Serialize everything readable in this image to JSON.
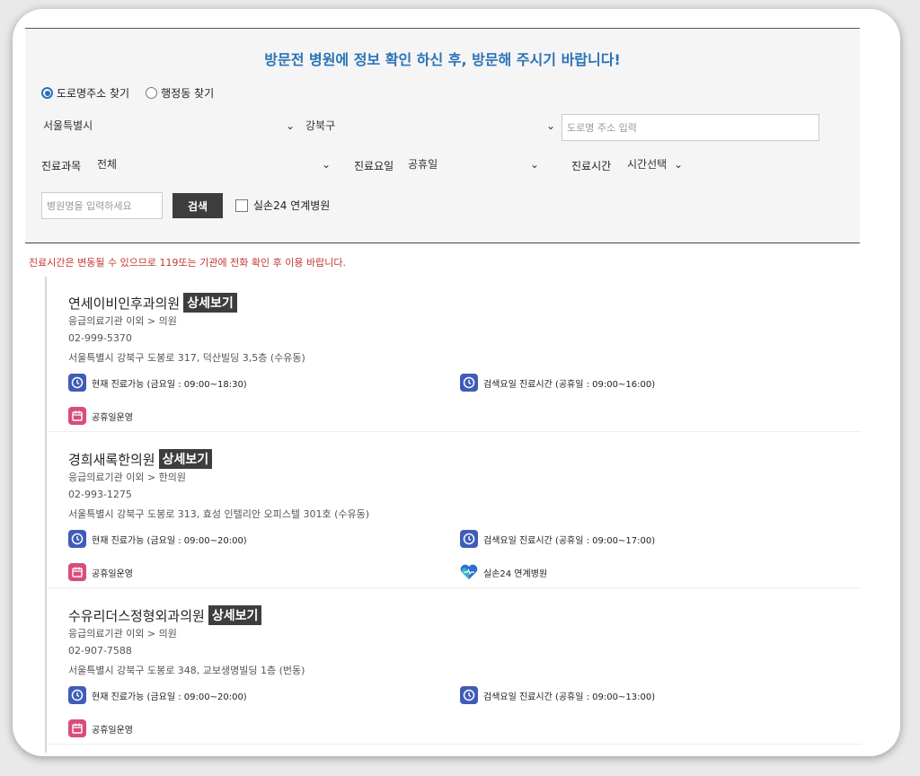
{
  "header": {
    "title": "방문전 병원에 정보 확인 하신 후, 방문해 주시기 바랍니다!"
  },
  "search": {
    "radio_road": "도로명주소 찾기",
    "radio_admin": "행정동 찾기",
    "city": "서울특별시",
    "district": "강북구",
    "road_placeholder": "도로명 주소 입력",
    "dept_label": "진료과목",
    "dept_value": "전체",
    "day_label": "진료요일",
    "day_value": "공휴일",
    "time_label": "진료시간",
    "time_value": "시간선택",
    "name_placeholder": "병원명을 입력하세요",
    "search_button": "검색",
    "checkbox_label": "실손24 연계병원"
  },
  "notice": "진료시간은 변동될 수 있으므로 119또는 기관에 전화 확인 후 이용 바랍니다.",
  "detail_label": "상세보기",
  "results": [
    {
      "name": "연세이비인후과의원",
      "category": "응급의료기관 이외 > 의원",
      "phone": "02-999-5370",
      "address": "서울특별시 강북구 도봉로 317, 덕산빌딩 3,5층 (수유동)",
      "now": "현재 진료가능 (금요일 : 09:00~18:30)",
      "search_day": "검색요일 진료시간 (공휴일 : 09:00~16:00)",
      "holiday": "공휴일운영",
      "silson": ""
    },
    {
      "name": "경희새록한의원",
      "category": "응급의료기관 이외 > 한의원",
      "phone": "02-993-1275",
      "address": "서울특별시 강북구 도봉로 313, 효성 인텔리안 오피스텔 301호 (수유동)",
      "now": "현재 진료가능 (금요일 : 09:00~20:00)",
      "search_day": "검색요일 진료시간 (공휴일 : 09:00~17:00)",
      "holiday": "공휴일운영",
      "silson": "실손24 연계병원"
    },
    {
      "name": "수유리더스정형외과의원",
      "category": "응급의료기관 이외 > 의원",
      "phone": "02-907-7588",
      "address": "서울특별시 강북구 도봉로 348, 교보생명빌딩 1층 (번동)",
      "now": "현재 진료가능 (금요일 : 09:00~20:00)",
      "search_day": "검색요일 진료시간 (공휴일 : 09:00~13:00)",
      "holiday": "공휴일운영",
      "silson": ""
    }
  ],
  "colors": {
    "title_blue": "#2a73b8",
    "notice_red": "#c53434",
    "dark_button": "#3d3d3d",
    "clock_icon": "#3f5cb8",
    "calendar_icon": "#d94d7a"
  }
}
